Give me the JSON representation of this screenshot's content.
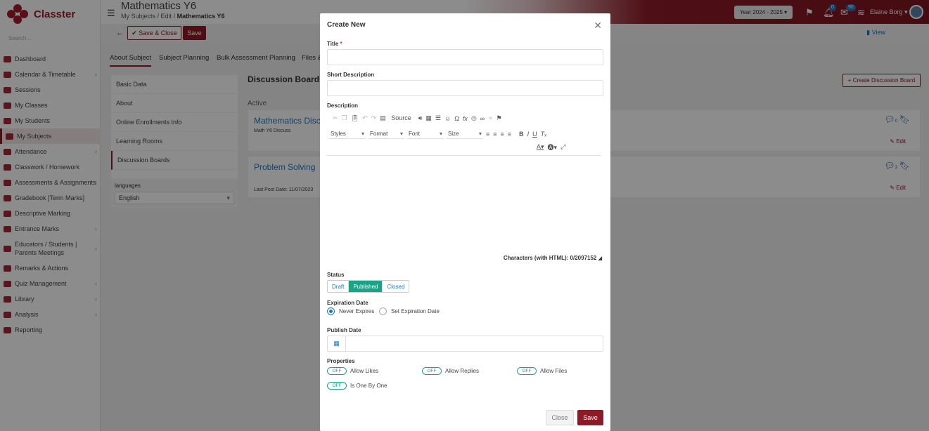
{
  "app": {
    "name": "Classter",
    "search_placeholder": "Search..."
  },
  "sidebar": {
    "items": [
      {
        "label": "Dashboard"
      },
      {
        "label": "Calendar & Timetable",
        "chev": "‹"
      },
      {
        "label": "Sessions"
      },
      {
        "label": "My Classes"
      },
      {
        "label": "My Students"
      },
      {
        "label": "My Subjects"
      },
      {
        "label": "Attendance",
        "chev": "‹"
      },
      {
        "label": "Classwork / Homework"
      },
      {
        "label": "Assessments & Assignments",
        "chev": "‹"
      },
      {
        "label": "Gradebook [Term Marks]"
      },
      {
        "label": "Descriptive Marking"
      },
      {
        "label": "Entrance Marks",
        "chev": "‹"
      },
      {
        "label": "Educators / Students | Parents Meetings",
        "chev": "‹"
      },
      {
        "label": "Remarks & Actions"
      },
      {
        "label": "Quiz Management",
        "chev": "‹"
      },
      {
        "label": "Library",
        "chev": "‹"
      },
      {
        "label": "Analysis",
        "chev": "‹"
      },
      {
        "label": "Reporting"
      }
    ]
  },
  "header": {
    "title": "Mathematics Y6",
    "crumb1": "My Subjects",
    "crumb2": "Edit",
    "crumb3": "Mathematics Y6",
    "year": "Year 2024 - 2025 ▾",
    "flag_icon": "flag-icon",
    "notif_count": "0",
    "msg_count": "90",
    "user": "Elaine Borg ▾"
  },
  "toolbar": {
    "save_close": "✔ Save & Close",
    "save": "Save",
    "view": "View"
  },
  "tabs": [
    "About Subject",
    "Subject Planning",
    "Bulk Assessment Planning",
    "Files &"
  ],
  "left_panel": {
    "items": [
      "Basic Data",
      "About",
      "Online Enrollments Info",
      "Learning Rooms",
      "Discussion Boards"
    ],
    "languages_label": "languages",
    "language": "English"
  },
  "main": {
    "title": "Discussion Boards",
    "create_label": "Create Discussion Board",
    "active_label": "Active",
    "cards": [
      {
        "title": "Mathematics Discu",
        "sub": "Math Y6 Discuss",
        "edit": "Edit",
        "count": "0"
      },
      {
        "title": "Problem Solving",
        "sub": "Last Post Date: 11/07/2023",
        "edit": "Edit",
        "count": "2"
      }
    ]
  },
  "modal": {
    "title": "Create New",
    "title_label": "Title",
    "req": "*",
    "short_desc_label": "Short Description",
    "desc_label": "Description",
    "editor": {
      "source": "Source",
      "styles": "Styles",
      "format": "Format",
      "font": "Font",
      "size": "Size",
      "chars": "Characters (with HTML): 0/2097152"
    },
    "status_label": "Status",
    "status_options": [
      "Draft",
      "Published",
      "Closed"
    ],
    "status_selected": "Published",
    "expiration_label": "Expiration Date",
    "never_expires": "Never Expires",
    "set_expiration": "Set Expiration Date",
    "publish_label": "Publish Date",
    "properties_label": "Properties",
    "toggle_off": "OFF",
    "props": [
      "Allow Likes",
      "Allow Replies",
      "Allow Files",
      "Is One By One"
    ],
    "close": "Close",
    "save": "Save"
  }
}
